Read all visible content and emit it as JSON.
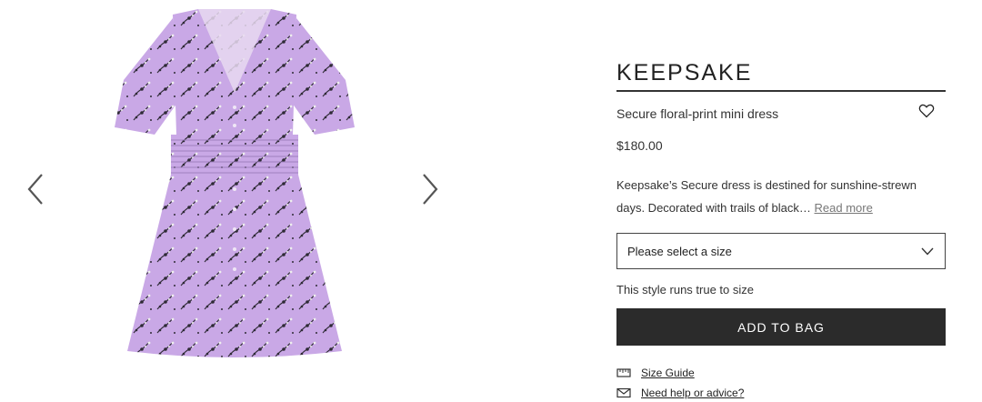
{
  "gallery": {
    "prev_icon": "chevron-left-icon",
    "next_icon": "chevron-right-icon",
    "image_colors": {
      "dress": "#c9a8e6",
      "print": "#2e2a35"
    }
  },
  "product": {
    "brand": "KEEPSAKE",
    "name": "Secure floral-print mini dress",
    "price": "$180.00",
    "description": "Keepsake’s Secure dress is destined for sunshine-strewn days. Decorated with trails of black…",
    "read_more": "Read more",
    "wishlist_icon": "heart-icon"
  },
  "size": {
    "select_label": "Please select a size",
    "fit_note": "This style runs true to size"
  },
  "actions": {
    "add_to_bag": "ADD TO BAG",
    "size_guide": "Size Guide",
    "help": "Need help or advice?"
  },
  "colors": {
    "primary_button": "#2b2b2b",
    "text": "#222222"
  }
}
